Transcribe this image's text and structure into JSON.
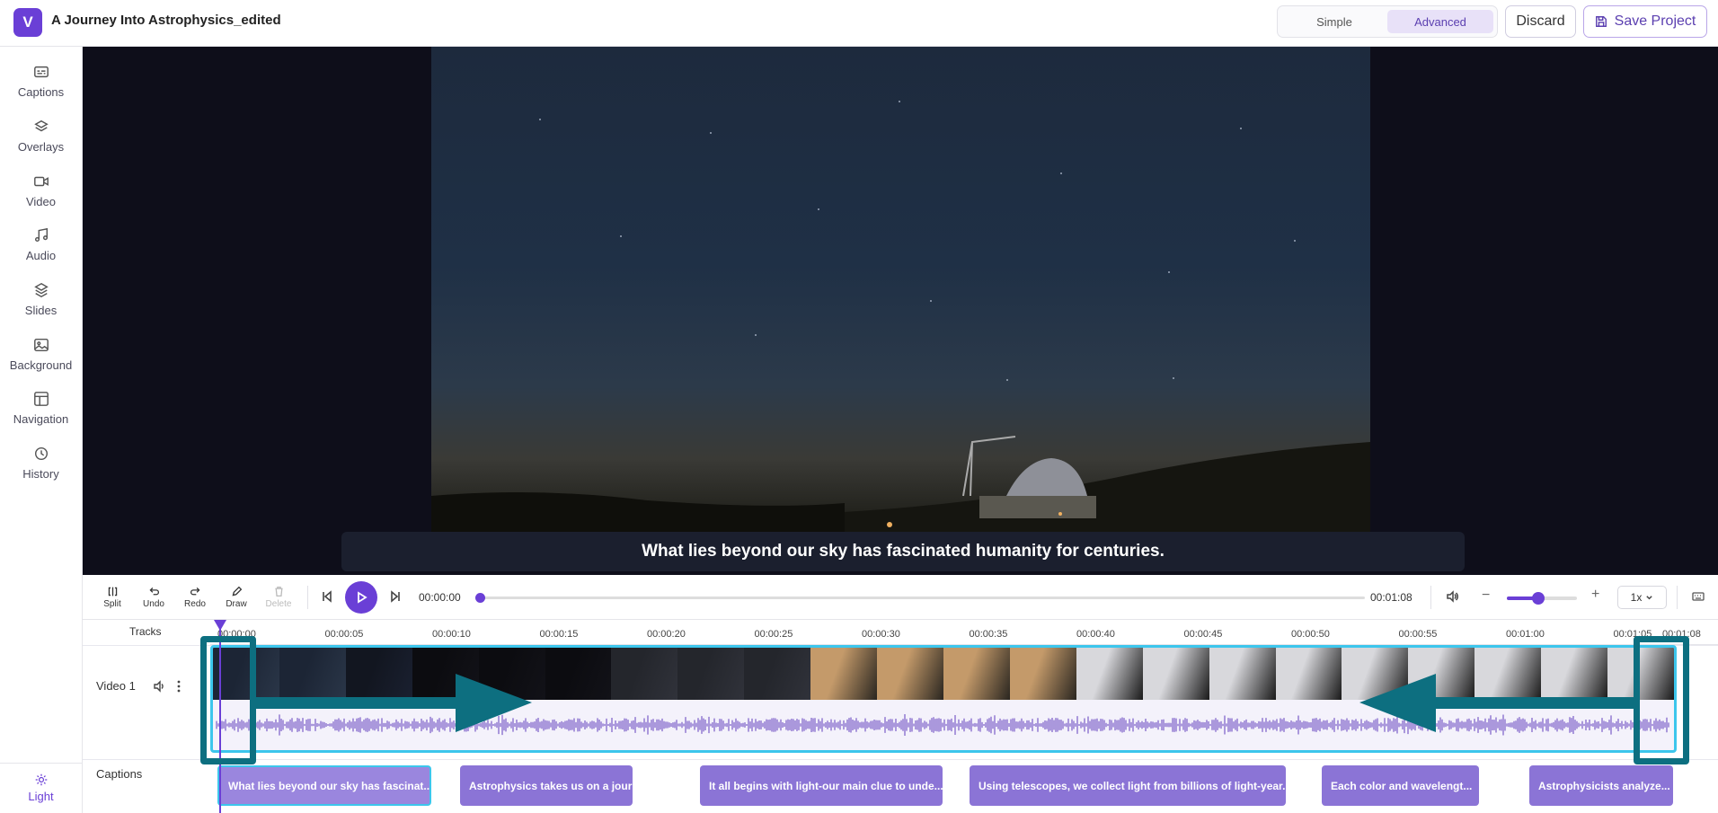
{
  "app": {
    "logo_letter": "V",
    "project_title": "A Journey Into Astrophysics_edited",
    "modes": [
      "Simple",
      "Advanced"
    ],
    "active_mode": "Advanced",
    "discard_label": "Discard",
    "save_label": "Save Project",
    "accent_color": "#6a3fd6"
  },
  "sidebar": {
    "items": [
      {
        "label": "Captions",
        "icon": "captions-icon"
      },
      {
        "label": "Overlays",
        "icon": "layers-icon"
      },
      {
        "label": "Video",
        "icon": "video-camera-icon"
      },
      {
        "label": "Audio",
        "icon": "music-note-icon"
      },
      {
        "label": "Slides",
        "icon": "slides-icon"
      },
      {
        "label": "Background",
        "icon": "image-icon"
      },
      {
        "label": "Navigation",
        "icon": "layout-icon"
      },
      {
        "label": "History",
        "icon": "history-icon"
      }
    ],
    "theme_label": "Light"
  },
  "preview": {
    "caption": "What lies beyond our sky has fascinated humanity for centuries."
  },
  "controls": {
    "tools": [
      {
        "label": "Split",
        "icon": "split-icon",
        "enabled": true
      },
      {
        "label": "Undo",
        "icon": "undo-icon",
        "enabled": true
      },
      {
        "label": "Redo",
        "icon": "redo-icon",
        "enabled": true
      },
      {
        "label": "Draw",
        "icon": "pencil-icon",
        "enabled": true
      },
      {
        "label": "Delete",
        "icon": "trash-icon",
        "enabled": false
      }
    ],
    "current_time": "00:00:00",
    "end_time": "00:01:08",
    "progress": 0,
    "zoom_level": 0.45,
    "speed": "1x"
  },
  "timeline": {
    "tracks_label": "Tracks",
    "ticks": [
      "00:00:00",
      "00:00:05",
      "00:00:10",
      "00:00:15",
      "00:00:20",
      "00:00:25",
      "00:00:30",
      "00:00:35",
      "00:00:40",
      "00:00:45",
      "00:00:50",
      "00:00:55",
      "00:01:00",
      "00:01:05",
      "00:01:08"
    ],
    "video_track_label": "Video 1",
    "captions_track_label": "Captions",
    "captions": [
      "What lies beyond our sky has fascinat...",
      "Astrophysics takes us on a journey ...",
      "It all begins with light-our main clue to unde...",
      "Using telescopes, we collect light from billions of light-year...",
      "Each color and wavelengt...",
      "Astrophysicists analyze..."
    ]
  }
}
